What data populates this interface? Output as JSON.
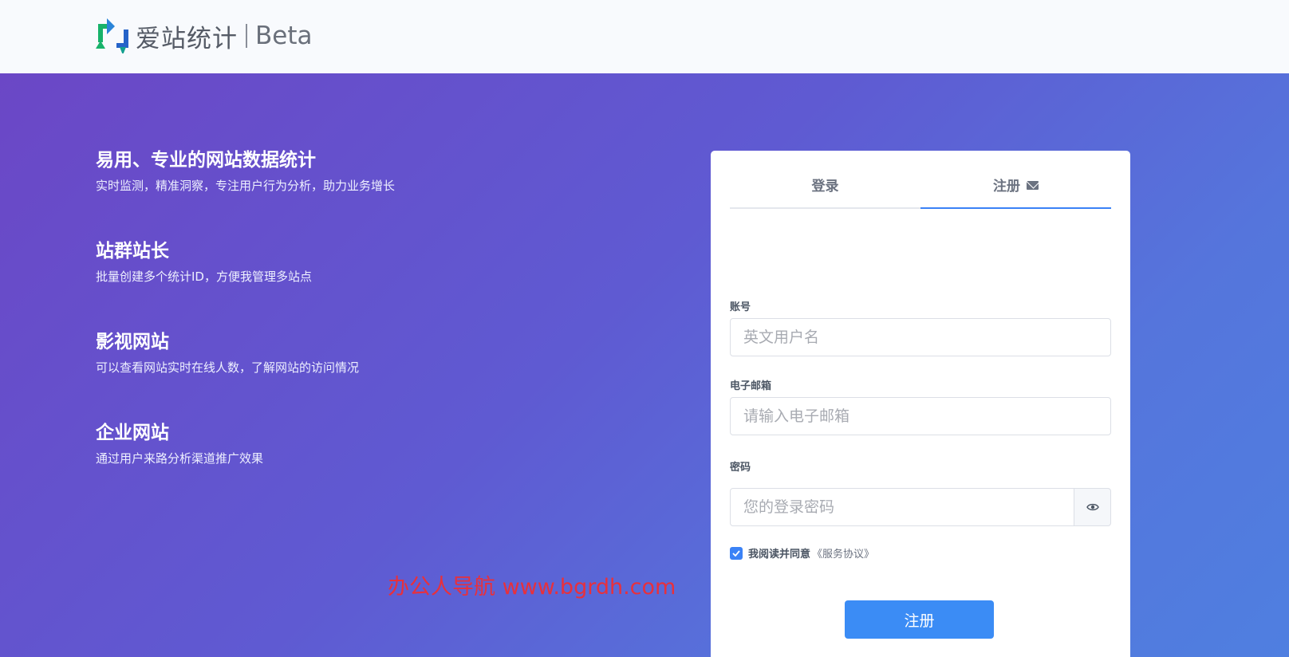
{
  "header": {
    "brand_name": "爱站统计",
    "brand_tag": "Beta",
    "logo_icon": "refresh-arrows-logo-icon"
  },
  "features": [
    {
      "title": "易用、专业的网站数据统计",
      "desc": "实时监测，精准洞察，专注用户行为分析，助力业务增长"
    },
    {
      "title": "站群站长",
      "desc": "批量创建多个统计ID，方便我管理多站点"
    },
    {
      "title": "影视网站",
      "desc": "可以查看网站实时在线人数，了解网站的访问情况"
    },
    {
      "title": "企业网站",
      "desc": "通过用户来路分析渠道推广效果"
    }
  ],
  "watermark": "办公人导航 www.bgrdh.com",
  "form": {
    "tabs": [
      {
        "label": "登录",
        "active": false
      },
      {
        "label": "注册",
        "active": true,
        "icon": "mail-icon"
      }
    ],
    "account": {
      "label": "账号",
      "placeholder": "英文用户名",
      "value": ""
    },
    "email": {
      "label": "电子邮箱",
      "placeholder": "请输入电子邮箱",
      "value": ""
    },
    "password": {
      "label": "密码",
      "placeholder": "您的登录密码",
      "value": "",
      "toggle_icon": "eye-icon"
    },
    "agree": {
      "text": "我阅读并同意",
      "link": "《服务协议》",
      "checked": true
    },
    "submit_label": "注册"
  },
  "colors": {
    "accent": "#3b8cf5",
    "gradient_start": "#6b47c6",
    "gradient_end": "#4f7fe0",
    "watermark": "#e8303c"
  }
}
